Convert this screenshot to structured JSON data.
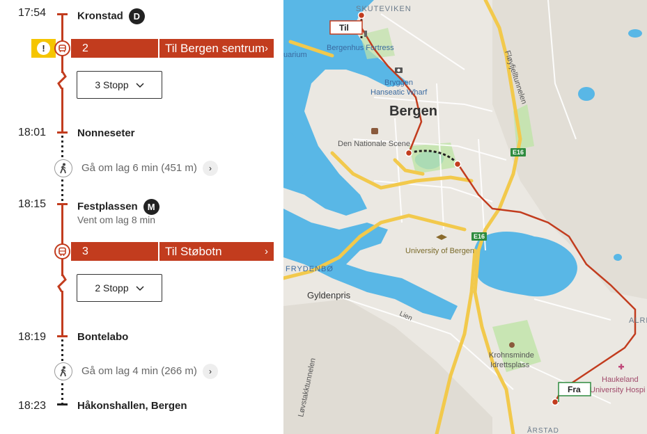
{
  "itinerary": {
    "stops": [
      {
        "time": "17:54",
        "name": "Kronstad",
        "badge": "D"
      },
      {
        "time": "18:01",
        "name": "Nonneseter"
      },
      {
        "time": "18:15",
        "name": "Festplassen",
        "badge": "M",
        "note": "Vent om lag 8 min"
      },
      {
        "time": "18:19",
        "name": "Bontelabo"
      },
      {
        "time": "18:23",
        "name": "Håkonshallen, Bergen"
      }
    ],
    "legs": [
      {
        "line": "2",
        "destination": "Til Bergen sentrum",
        "stops_label": "3 Stopp",
        "warning": "!"
      },
      {
        "line": "3",
        "destination": "Til Støbotn",
        "stops_label": "2 Stopp"
      }
    ],
    "walks": [
      {
        "text": "Gå om lag 6 min (451 m)"
      },
      {
        "text": "Gå om lag 4 min (266 m)"
      }
    ],
    "chevron": "›",
    "dropdown": "⌄"
  },
  "map": {
    "labels": {
      "skuteviken": "SKUTEVIKEN",
      "bergenhus": "Bergenhus Fortress",
      "bryggen1": "Bryggen",
      "bryggen2": "Hanseatic Wharf",
      "bergen": "Bergen",
      "nationale": "Den Nationale Scene",
      "floyfjell": "Fløyfjelltunnelen",
      "e16a": "E16",
      "e16b": "E16",
      "university": "University of Bergen",
      "frydenbo": "FRYDENBØ",
      "gyldenpris": "Gyldenpris",
      "lien": "Lien",
      "krohnsminde1": "Krohnsminde",
      "krohnsminde2": "Idrettsplass",
      "haukeland1": "Haukeland",
      "haukeland2": "University Hospi",
      "lovstakk": "Løvstakktunnelen",
      "arstad": "ÅRSTAD",
      "alre": "ALRE",
      "aquarium": "uarium"
    },
    "callouts": {
      "to": "Til",
      "from": "Fra"
    },
    "colors": {
      "route": "#c23c1e",
      "water": "#59b7e6",
      "park": "#bfe3a8",
      "land": "#ebe8e2",
      "road_major": "#f2c94c",
      "road_minor": "#ffffff"
    }
  }
}
